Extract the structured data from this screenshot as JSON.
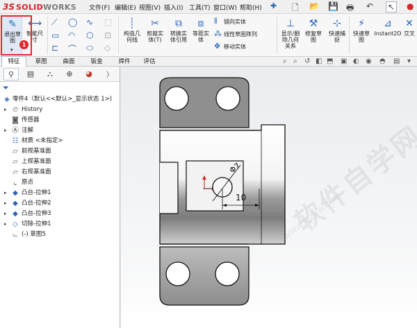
{
  "app": {
    "logo_ds": "3S",
    "logo_solid": "SOLID",
    "logo_works": "WORKS"
  },
  "menu": [
    "文件(F)",
    "编辑(E)",
    "视图(V)",
    "插入(I)",
    "工具(T)",
    "窗口(W)",
    "帮助(H)"
  ],
  "commands": {
    "exit_sketch": "退出草\n图",
    "smart_dimension": "智能尺\n寸",
    "construction_geometry": "构造几\n何线",
    "trim_entities": "剪裁实\n体(T)",
    "convert_entities": "转换实\n体引用",
    "offset_entities": "等距实\n体",
    "mirror_entities": "镜向实体",
    "linear_pattern": "线性草图阵列",
    "move_entities": "移动实体",
    "display_delete_relations": "显示/删\n除几何\n关系",
    "repair_sketch": "修复草\n图",
    "quick_snaps": "快速捕\n捉",
    "rapid_sketch": "快速草\n图",
    "instant2d": "Instant2D",
    "intersection_curve": "交叉"
  },
  "callout_number": "1",
  "tabs": [
    "特征",
    "草图",
    "曲面",
    "钣金",
    "焊件",
    "评估"
  ],
  "active_tab": "特征",
  "tree": {
    "part_name": "零件4（默认<<默认>_显示状态 1>)",
    "items": [
      {
        "label": "History",
        "icon": "history-icon",
        "expandable": true
      },
      {
        "label": "传感器",
        "icon": "sensor-icon",
        "expandable": false
      },
      {
        "label": "注解",
        "icon": "annotation-icon",
        "expandable": true
      },
      {
        "label": "材质 <未指定>",
        "icon": "material-icon",
        "expandable": false
      },
      {
        "label": "前视基准面",
        "icon": "plane-icon",
        "expandable": false
      },
      {
        "label": "上视基准面",
        "icon": "plane-icon",
        "expandable": false
      },
      {
        "label": "右视基准面",
        "icon": "plane-icon",
        "expandable": false
      },
      {
        "label": "原点",
        "icon": "origin-icon",
        "expandable": false
      },
      {
        "label": "凸台-拉伸1",
        "icon": "boss-extrude-icon",
        "expandable": true
      },
      {
        "label": "凸台-拉伸2",
        "icon": "boss-extrude-icon",
        "expandable": true
      },
      {
        "label": "凸台-拉伸3",
        "icon": "boss-extrude-icon",
        "expandable": true
      },
      {
        "label": "切除-拉伸1",
        "icon": "cut-extrude-icon",
        "expandable": true
      },
      {
        "label": "(-) 草图5",
        "icon": "sketch-icon",
        "expandable": false
      }
    ]
  },
  "drawing": {
    "diameter_label": "7",
    "diameter_symbol": "Φ",
    "distance_label": "10"
  },
  "watermark": "软件自学网",
  "watermark_url": "WWW.RJZXW.COM"
}
